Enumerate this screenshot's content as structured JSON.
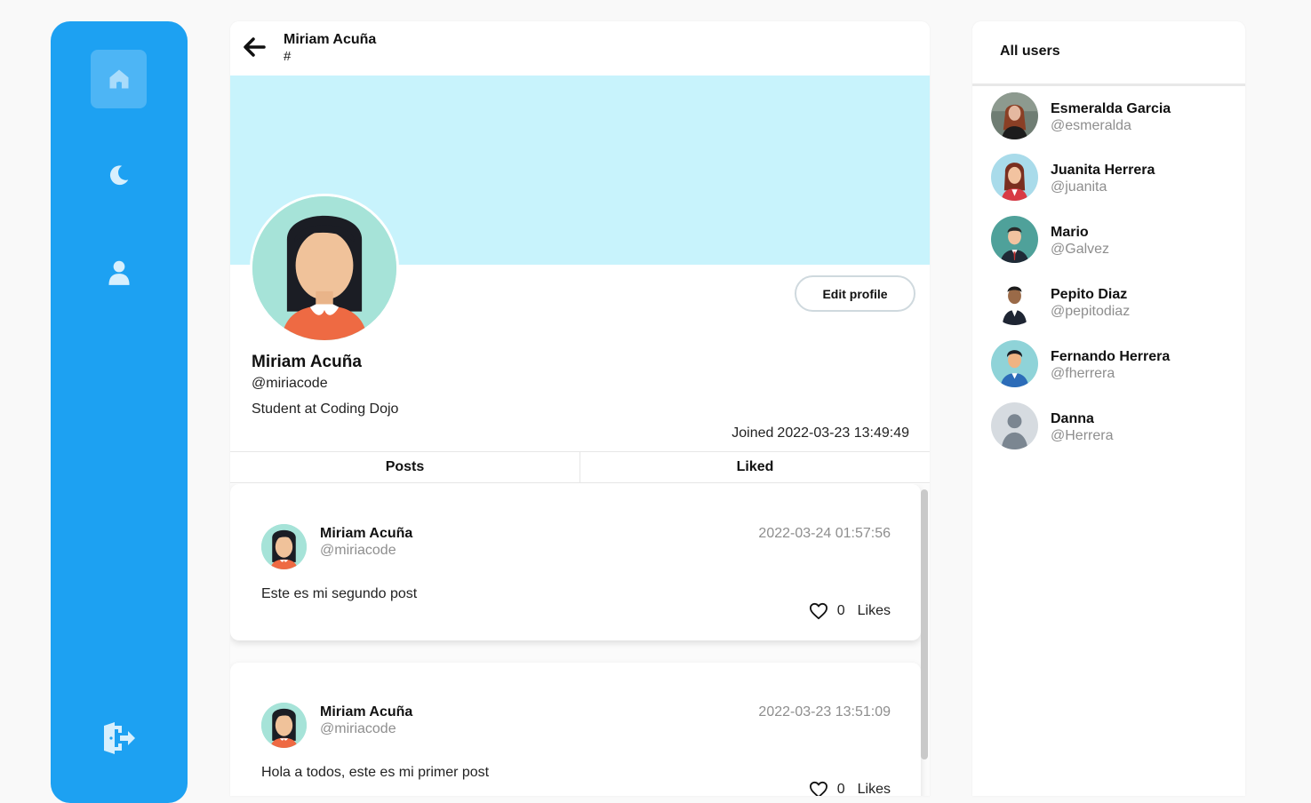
{
  "nav": {
    "items": [
      {
        "icon": "home-icon",
        "active": true
      },
      {
        "icon": "moon-icon",
        "active": false
      },
      {
        "icon": "user-icon",
        "active": false
      },
      {
        "icon": "logout-icon",
        "active": false
      }
    ],
    "accent": "#1da1f2"
  },
  "header": {
    "name": "Miriam Acuña",
    "sub": "#"
  },
  "profile": {
    "name": "Miriam Acuña",
    "handle": "@miriacode",
    "bio": "Student at Coding Dojo",
    "joined_label": "Joined",
    "joined_date": "2022-03-23 13:49:49",
    "edit_label": "Edit profile",
    "banner_color": "#c8f3fc"
  },
  "tabs": [
    {
      "label": "Posts"
    },
    {
      "label": "Liked"
    }
  ],
  "posts": [
    {
      "name": "Miriam Acuña",
      "handle": "@miriacode",
      "date": "2022-03-24 01:57:56",
      "text": "Este es mi segundo post",
      "likes": "0",
      "likes_label": "Likes"
    },
    {
      "name": "Miriam Acuña",
      "handle": "@miriacode",
      "date": "2022-03-23 13:51:09",
      "text": "Hola a todos, este es mi primer post",
      "likes": "0",
      "likes_label": "Likes"
    }
  ],
  "users_panel": {
    "title": "All users",
    "users": [
      {
        "name": "Esmeralda Garcia",
        "handle": "@esmeralda"
      },
      {
        "name": "Juanita Herrera",
        "handle": "@juanita"
      },
      {
        "name": "Mario",
        "handle": "@Galvez"
      },
      {
        "name": "Pepito Diaz",
        "handle": "@pepitodiaz"
      },
      {
        "name": "Fernando Herrera",
        "handle": "@fherrera"
      },
      {
        "name": "Danna",
        "handle": "@Herrera"
      }
    ]
  }
}
